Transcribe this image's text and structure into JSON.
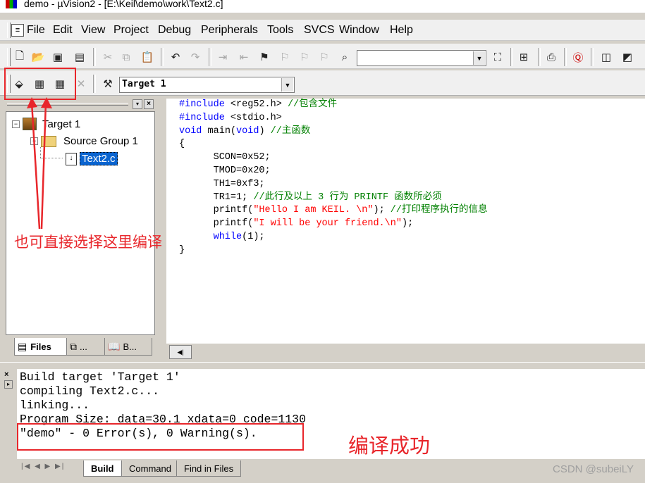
{
  "window": {
    "title": "demo  - µVision2 - [E:\\Keil\\demo\\work\\Text2.c]"
  },
  "menu": [
    "File",
    "Edit",
    "View",
    "Project",
    "Debug",
    "Peripherals",
    "Tools",
    "SVCS",
    "Window",
    "Help"
  ],
  "toolbar": {
    "find_combo_value": "",
    "target_combo_value": "Target 1"
  },
  "project_tree": {
    "target": "Target 1",
    "group": "Source Group 1",
    "file": "Text2.c"
  },
  "panel_tabs": [
    "Files",
    "...",
    "B..."
  ],
  "code_lines": [
    [
      {
        "t": "#include ",
        "c": "pp"
      },
      {
        "t": "<reg52.h> ",
        "c": ""
      },
      {
        "t": "//包含文件",
        "c": "cm"
      }
    ],
    [
      {
        "t": "#include ",
        "c": "pp"
      },
      {
        "t": "<stdio.h>",
        "c": ""
      }
    ],
    [
      {
        "t": "void ",
        "c": "kw"
      },
      {
        "t": "main(",
        "c": ""
      },
      {
        "t": "void",
        "c": "kw"
      },
      {
        "t": ") ",
        "c": ""
      },
      {
        "t": "//主函数",
        "c": "cm"
      }
    ],
    [
      {
        "t": "{",
        "c": ""
      }
    ],
    [
      {
        "t": "      SCON=0x52;",
        "c": ""
      }
    ],
    [
      {
        "t": "      TMOD=0x20;",
        "c": ""
      }
    ],
    [
      {
        "t": "      TH1=0xf3;",
        "c": ""
      }
    ],
    [
      {
        "t": "      TR1=1; ",
        "c": ""
      },
      {
        "t": "//此行及以上 3 行为 PRINTF 函数所必须",
        "c": "cm"
      }
    ],
    [
      {
        "t": "      printf(",
        "c": ""
      },
      {
        "t": "\"Hello I am KEIL. \\n\"",
        "c": "st"
      },
      {
        "t": "); ",
        "c": ""
      },
      {
        "t": "//打印程序执行的信息",
        "c": "cm"
      }
    ],
    [
      {
        "t": "      printf(",
        "c": ""
      },
      {
        "t": "\"I will be your friend.\\n\"",
        "c": "st"
      },
      {
        "t": ");",
        "c": ""
      }
    ],
    [
      {
        "t": "      ",
        "c": ""
      },
      {
        "t": "while",
        "c": "kw"
      },
      {
        "t": "(1);",
        "c": ""
      }
    ],
    [
      {
        "t": "}",
        "c": ""
      }
    ]
  ],
  "output": {
    "lines": [
      "Build target 'Target 1'",
      "compiling Text2.c...",
      "linking...",
      "Program Size: data=30.1 xdata=0 code=1130",
      "\"demo\" - 0 Error(s), 0 Warning(s)."
    ],
    "tabs": [
      "Build",
      "Command",
      "Find in Files"
    ]
  },
  "annotations": {
    "toolbar_note": "也可直接选择这里编译",
    "success_note": "编译成功",
    "accent_color": "#e8262b"
  },
  "watermark": "CSDN @subeiLY"
}
